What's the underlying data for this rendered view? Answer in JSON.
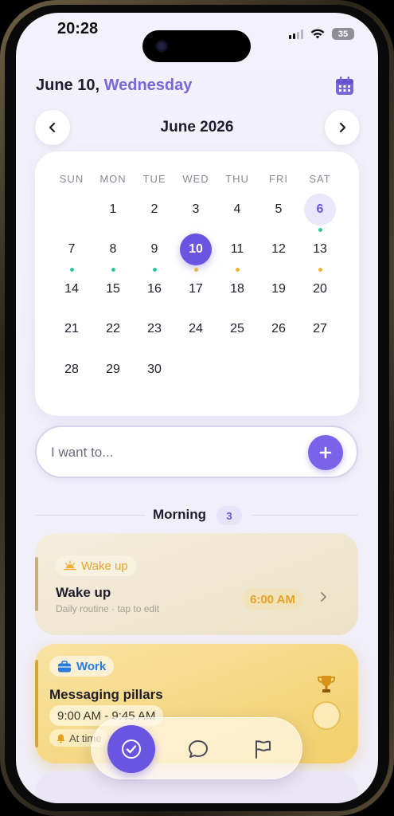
{
  "status_bar": {
    "time": "20:28",
    "battery": "35"
  },
  "header": {
    "date_prefix": "June 10,",
    "weekday": "Wednesday"
  },
  "calendar": {
    "month_label": "June 2026",
    "weekdays": [
      "SUN",
      "MON",
      "TUE",
      "WED",
      "THU",
      "FRI",
      "SAT"
    ],
    "days": [
      "1",
      "2",
      "3",
      "4",
      "5",
      "6",
      "7",
      "8",
      "9",
      "10",
      "11",
      "12",
      "13",
      "14",
      "15",
      "16",
      "17",
      "18",
      "19",
      "20",
      "21",
      "22",
      "23",
      "24",
      "25",
      "26",
      "27",
      "28",
      "29",
      "30"
    ],
    "today": "10",
    "selected": "6"
  },
  "quick_add": {
    "placeholder": "I want to..."
  },
  "section": {
    "title": "Morning",
    "count": "3"
  },
  "tasks": [
    {
      "tag": "Wake up",
      "title": "Wake up",
      "subtitle": "Daily routine · tap to edit",
      "time": "6:00 AM"
    },
    {
      "tag": "Work",
      "title": "Messaging pillars",
      "time": "9:00 AM - 9:45 AM",
      "alert": "At time"
    }
  ],
  "colors": {
    "accent": "#6a55e0",
    "weekday_accent": "#7a66d8",
    "dot_teal": "#2cc9a0",
    "dot_amber": "#f3b52e",
    "work_card": "#f3cf6b",
    "wake_card": "#ece2c8"
  },
  "icons": {
    "calendar": "calendar-icon",
    "prev": "chevron-left-icon",
    "next": "chevron-right-icon",
    "add": "plus-icon",
    "tasks": "check-icon",
    "chat": "chat-bubble-icon",
    "goals": "flag-icon"
  }
}
